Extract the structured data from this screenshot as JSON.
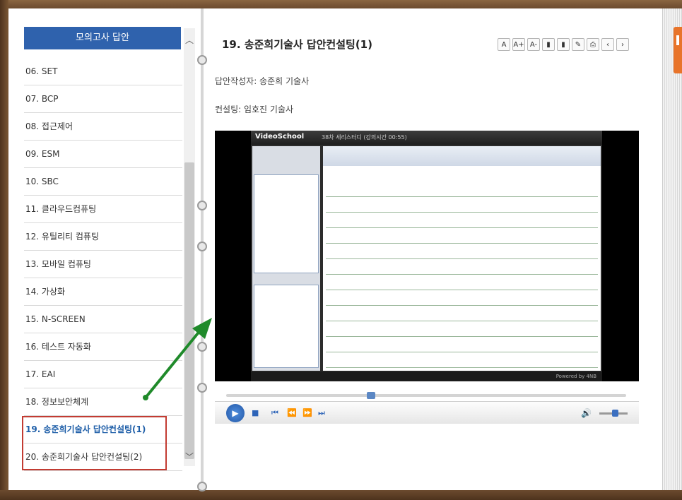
{
  "left_pane": {
    "header": "모의고사 답안",
    "items": [
      {
        "label": "06. SET",
        "active": false
      },
      {
        "label": "07. BCP",
        "active": false
      },
      {
        "label": "08. 접근제어",
        "active": false
      },
      {
        "label": "09. ESM",
        "active": false
      },
      {
        "label": "10. SBC",
        "active": false
      },
      {
        "label": "11. 클라우드컴퓨팅",
        "active": false
      },
      {
        "label": "12. 유틸리티 컴퓨팅",
        "active": false
      },
      {
        "label": "13. 모바일 컴퓨팅",
        "active": false
      },
      {
        "label": "14. 가상화",
        "active": false
      },
      {
        "label": "15. N-SCREEN",
        "active": false
      },
      {
        "label": "16. 테스트 자동화",
        "active": false
      },
      {
        "label": "17. EAI",
        "active": false
      },
      {
        "label": "18. 정보보안체계",
        "active": false
      },
      {
        "label": "19. 송준희기술사 답안컨설팅(1)",
        "active": true
      },
      {
        "label": "20. 송준희기술사 답안컨설팅(2)",
        "active": false
      }
    ]
  },
  "document": {
    "title": "19. 송준희기술사 답안컨설팅(1)",
    "author_line": "답안작성자: 송준희 기술사",
    "consultant_line": "컨설팅: 임호진 기술사"
  },
  "toolbar": {
    "icons": [
      "font-size-reset-icon",
      "font-size-increase-icon",
      "font-size-decrease-icon",
      "bookmark-icon",
      "bookmark-list-icon",
      "memo-icon",
      "print-icon",
      "prev-page-icon",
      "next-page-icon"
    ],
    "glyphs": [
      "A",
      "A+",
      "A-",
      "▮",
      "▮",
      "✎",
      "⎙",
      "‹",
      "›"
    ]
  },
  "video": {
    "screen_brand": "VideoSchool",
    "screen_caption": "38차 세리스터디 (강의시간 00:55)",
    "screen_footer": "Powered by 4NB",
    "play_icon": "▶",
    "stop_icon": "■",
    "prev_icon": "⏮",
    "rewind_icon": "⏪",
    "forward_icon": "⏩",
    "next_icon": "⏭",
    "volume_icon": "🔊",
    "progress": 0.36,
    "volume": 0.6
  },
  "colors": {
    "header_bg": "#2f62ad",
    "active_text": "#1e5ea8",
    "highlight_border": "#c23b32",
    "arrow": "#1f8a2a"
  }
}
